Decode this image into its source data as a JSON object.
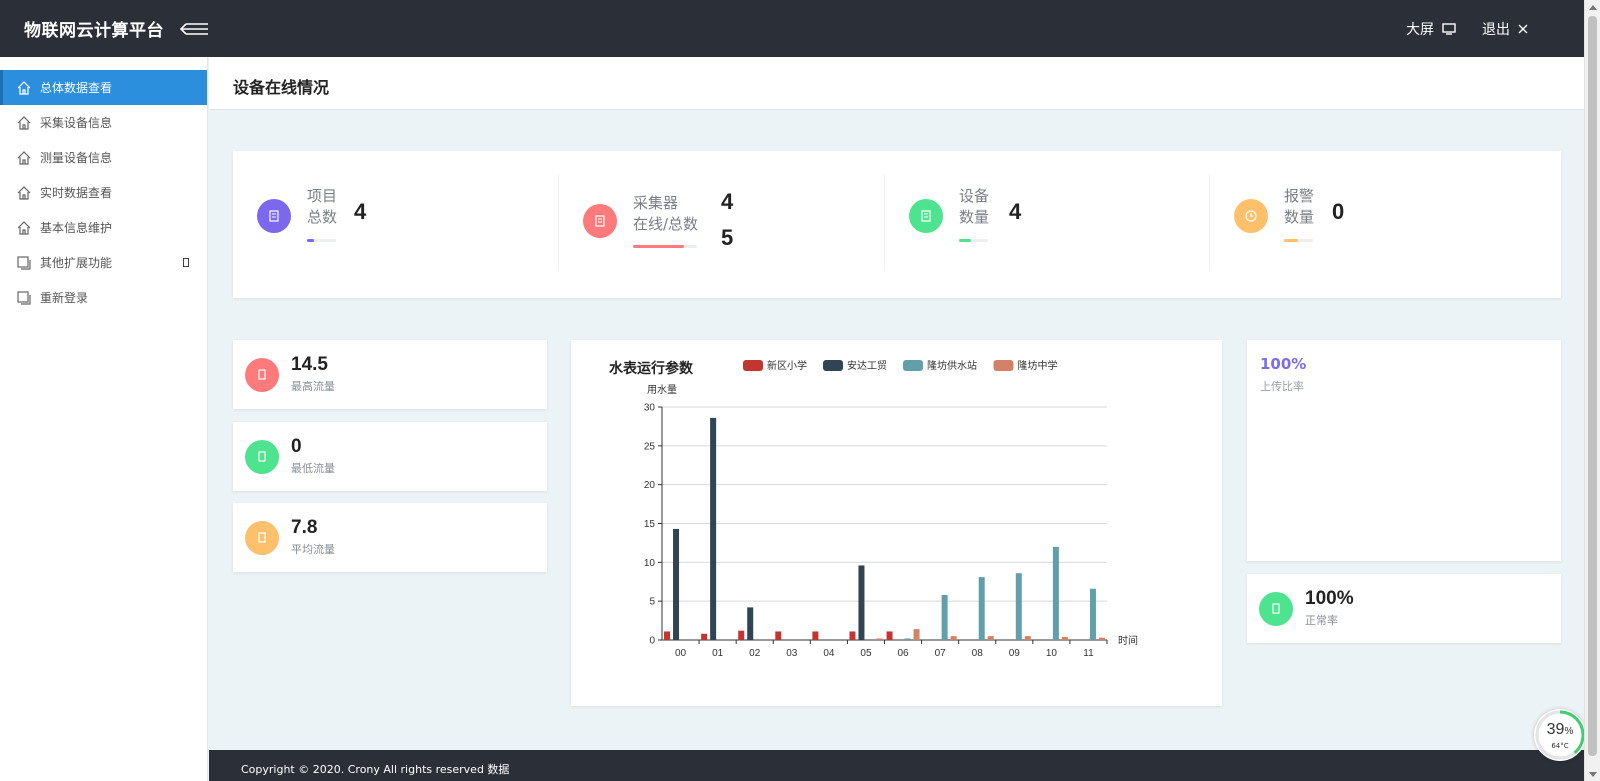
{
  "header": {
    "brand": "物联网云计算平台",
    "bigscreen_label": "大屏",
    "logout_label": "退出"
  },
  "sidebar": {
    "items": [
      {
        "label": "总体数据查看",
        "icon": "home-icon",
        "active": true
      },
      {
        "label": "采集设备信息",
        "icon": "home-icon"
      },
      {
        "label": "测量设备信息",
        "icon": "home-icon"
      },
      {
        "label": "实时数据查看",
        "icon": "home-icon"
      },
      {
        "label": "基本信息维护",
        "icon": "home-icon"
      },
      {
        "label": "其他扩展功能",
        "icon": "window-icon",
        "has_submenu": true
      },
      {
        "label": "重新登录",
        "icon": "window-icon"
      }
    ]
  },
  "page": {
    "title": "设备在线情况"
  },
  "stats": [
    {
      "label_line1": "项目",
      "label_line2": "总数",
      "value": "4",
      "color": "#7b68ee",
      "icon": "building-icon",
      "progress": 0.25
    },
    {
      "label_line1": "采集器",
      "label_line2": "在线/总数",
      "value": "4",
      "value2": "5",
      "color": "#ff7a7a",
      "icon": "collector-icon",
      "progress": 0.8
    },
    {
      "label_line1": "设备",
      "label_line2": "数量",
      "value": "4",
      "color": "#4ee38f",
      "icon": "device-icon",
      "progress": 0.4
    },
    {
      "label_line1": "报警",
      "label_line2": "数量",
      "value": "0",
      "color": "#ffc06b",
      "icon": "clock-icon",
      "progress": 0.5
    }
  ],
  "flow": [
    {
      "value": "14.5",
      "label": "最高流量",
      "color": "#ff7a7a",
      "icon": "flow-icon"
    },
    {
      "value": "0",
      "label": "最低流量",
      "color": "#4ee38f",
      "icon": "flow-icon"
    },
    {
      "value": "7.8",
      "label": "平均流量",
      "color": "#ffc06b",
      "icon": "flow-icon"
    }
  ],
  "rates": {
    "upload_value": "100%",
    "upload_label": "上传比率",
    "normal_value": "100%",
    "normal_label": "正常率",
    "normal_color": "#4ee38f"
  },
  "footer": {
    "text": "Copyright © 2020. Crony All rights reserved 数据"
  },
  "gauge": {
    "percent": "39",
    "unit": "%",
    "temp": "64°C"
  },
  "chart_data": {
    "type": "bar",
    "title": "水表运行参数",
    "ylabel": "用水量",
    "xlabel": "时间",
    "categories": [
      "00",
      "01",
      "02",
      "03",
      "04",
      "05",
      "06",
      "07",
      "08",
      "09",
      "10",
      "11"
    ],
    "ylim": [
      0,
      30
    ],
    "yticks": [
      0,
      5,
      10,
      15,
      20,
      25,
      30
    ],
    "legend_position": "top",
    "series": [
      {
        "name": "新区小学",
        "color": "#c23531",
        "values": [
          1.1,
          0.8,
          1.2,
          1.1,
          1.1,
          1.1,
          1.1,
          0,
          0,
          0,
          0,
          0
        ]
      },
      {
        "name": "安达工贸",
        "color": "#2f4554",
        "values": [
          14.3,
          28.6,
          4.2,
          0,
          0,
          9.6,
          0,
          0,
          0,
          0,
          0,
          0
        ]
      },
      {
        "name": "隆坊供水站",
        "color": "#61a0a8",
        "values": [
          0,
          0,
          0,
          0,
          0,
          0,
          0.2,
          5.8,
          8.1,
          8.6,
          12,
          6.6
        ]
      },
      {
        "name": "隆坊中学",
        "color": "#d48265",
        "values": [
          0,
          0,
          0,
          0,
          0,
          0.2,
          1.4,
          0.5,
          0.5,
          0.5,
          0.4,
          0.3
        ]
      }
    ]
  }
}
